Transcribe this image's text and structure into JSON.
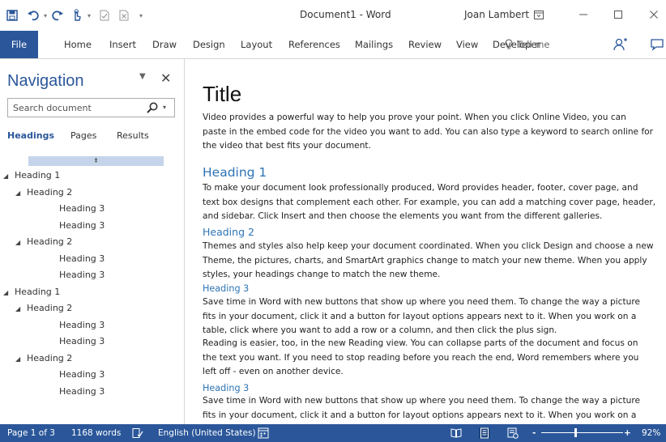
{
  "window": {
    "title": "Document1 - Word",
    "user": "Joan Lambert",
    "controls": [
      "ribbon-display-options",
      "minimize",
      "maximize",
      "close"
    ]
  },
  "quick_access": {
    "icons": [
      "save-icon",
      "undo-icon",
      "redo-icon",
      "touch-mode-icon",
      "checkbox-icon",
      "checkbox-x-icon",
      "customize-qat-icon"
    ]
  },
  "ribbon": {
    "tabs": [
      "File",
      "Home",
      "Insert",
      "Draw",
      "Design",
      "Layout",
      "References",
      "Mailings",
      "Review",
      "View",
      "Developer"
    ],
    "tell_me": "Tell me"
  },
  "navigation": {
    "title": "Navigation",
    "search_placeholder": "Search document",
    "tabs": [
      "Headings",
      "Pages",
      "Results"
    ],
    "active_tab": "Headings",
    "tree": [
      {
        "label": "Heading 1",
        "level": 1,
        "expanded": true
      },
      {
        "label": "Heading 2",
        "level": 2,
        "expanded": true
      },
      {
        "label": "Heading 3",
        "level": 3
      },
      {
        "label": "Heading 3",
        "level": 3
      },
      {
        "label": "Heading 2",
        "level": 2,
        "expanded": true
      },
      {
        "label": "Heading 3",
        "level": 3
      },
      {
        "label": "Heading 3",
        "level": 3
      },
      {
        "label": "Heading 1",
        "level": 1,
        "expanded": true
      },
      {
        "label": "Heading 2",
        "level": 2,
        "expanded": true
      },
      {
        "label": "Heading 3",
        "level": 3
      },
      {
        "label": "Heading 3",
        "level": 3
      },
      {
        "label": "Heading 2",
        "level": 2,
        "expanded": true
      },
      {
        "label": "Heading 3",
        "level": 3
      },
      {
        "label": "Heading 3",
        "level": 3
      }
    ]
  },
  "document": {
    "title": "Title",
    "intro": [
      "Video provides a powerful way to help you prove your point. When you click Online Video, you can",
      "paste in the embed code for the video you want to add. You can also type a keyword to search online for",
      "the video that best fits your document."
    ],
    "heading1": "Heading 1",
    "para1": [
      "To make your document look professionally produced, Word provides header, footer, cover page, and",
      "text box designs that complement each other. For example, you can add a matching cover page, header,",
      "and sidebar. Click Insert and then choose the elements you want from the different galleries."
    ],
    "heading2": "Heading 2",
    "para2": [
      "Themes and styles also help keep your document coordinated. When you click Design and choose a new",
      "Theme, the pictures, charts, and SmartArt graphics change to match your new theme. When you apply",
      "styles, your headings change to match the new theme."
    ],
    "heading3a": "Heading 3",
    "para3": [
      "Save time in Word with new buttons that show up where you need them. To change the way a picture",
      "fits in your document, click it and a button for layout options appears next to it. When you work on a",
      "table, click where you want to add a row or a column, and then click the plus sign."
    ],
    "para4": [
      "Reading is easier, too, in the new Reading view. You can collapse parts of the document and focus on",
      "the text you want. If you need to stop reading before you reach the end, Word remembers where you",
      "left off - even on another device."
    ],
    "heading3b": "Heading 3",
    "para5": [
      "Save time in Word with new buttons that show up where you need them. To change the way a picture",
      "fits in your document, click it and a button for layout options appears next to it. When you work on a"
    ]
  },
  "status_bar": {
    "page": "Page 1 of 3",
    "words": "1168 words",
    "language": "English (United States)",
    "zoom": "92%",
    "zoom_minus": "-",
    "zoom_plus": "+",
    "zoom_level": 0.92
  },
  "colors": {
    "brand": "#2b579a",
    "heading": "#2e74b5",
    "collapse_bar": "#c5d4ea"
  }
}
